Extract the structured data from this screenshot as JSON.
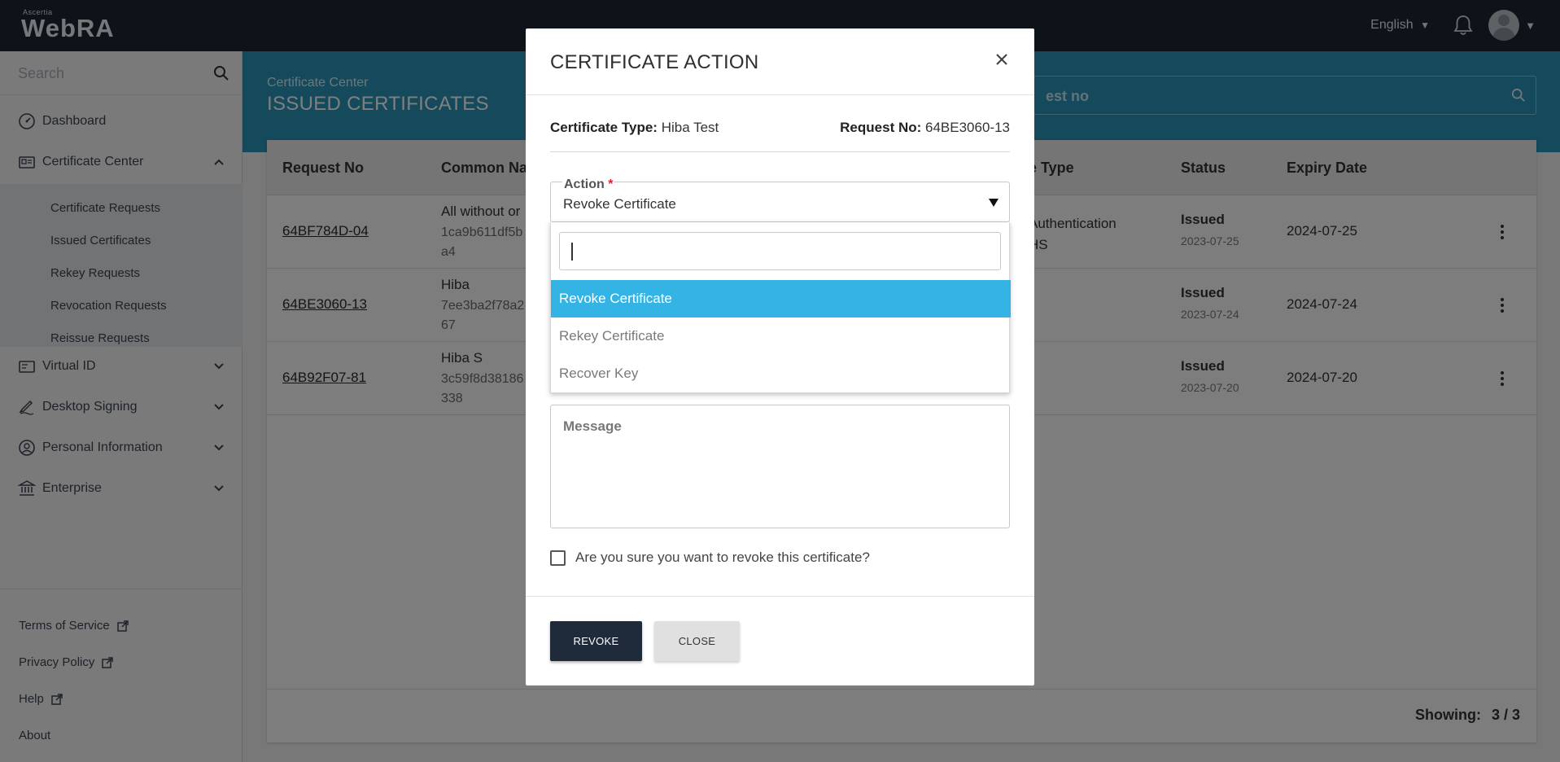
{
  "topbar": {
    "brand_small": "Ascertia",
    "brand": "WebRA",
    "language": "English"
  },
  "sidebar": {
    "search_placeholder": "Search",
    "items": [
      {
        "label": "Dashboard"
      },
      {
        "label": "Certificate Center"
      },
      {
        "label": "Virtual ID"
      },
      {
        "label": "Desktop Signing"
      },
      {
        "label": "Personal Information"
      },
      {
        "label": "Enterprise"
      }
    ],
    "subitems": [
      {
        "label": "Certificate Requests"
      },
      {
        "label": "Issued Certificates"
      },
      {
        "label": "Rekey Requests"
      },
      {
        "label": "Revocation Requests"
      },
      {
        "label": "Reissue Requests"
      }
    ],
    "footer_links": [
      {
        "label": "Terms of Service"
      },
      {
        "label": "Privacy Policy"
      },
      {
        "label": "Help"
      },
      {
        "label": "About"
      }
    ]
  },
  "header": {
    "breadcrumb": "Certificate Center",
    "title": "ISSUED CERTIFICATES",
    "search_placeholder": "est no"
  },
  "table": {
    "columns": [
      "Request No",
      "Common Na",
      "e Type",
      "Status",
      "Expiry Date"
    ],
    "rows": [
      {
        "request_no": "64BF784D-04",
        "cn_name": "All without or",
        "cn_detail": "1ca9b611df5b\na4",
        "type": "Authentication\nHS",
        "status": "Issued",
        "status_date": "2023-07-25",
        "expiry": "2024-07-25"
      },
      {
        "request_no": "64BE3060-13",
        "cn_name": "Hiba",
        "cn_detail": "7ee3ba2f78a2\n67",
        "type": "",
        "status": "Issued",
        "status_date": "2023-07-24",
        "expiry": "2024-07-24"
      },
      {
        "request_no": "64B92F07-81",
        "cn_name": "Hiba S",
        "cn_detail": "3c59f8d38186\n338",
        "type": "",
        "status": "Issued",
        "status_date": "2023-07-20",
        "expiry": "2024-07-20"
      }
    ],
    "showing_label": "Showing:",
    "showing_value": "3 / 3"
  },
  "modal": {
    "title": "CERTIFICATE ACTION",
    "cert_type_label": "Certificate Type:",
    "cert_type_value": "Hiba Test",
    "request_no_label": "Request No:",
    "request_no_value": "64BE3060-13",
    "action_label": "Action",
    "action_required": "*",
    "action_value": "Revoke Certificate",
    "options": [
      "Revoke Certificate",
      "Rekey Certificate",
      "Recover Key"
    ],
    "message_placeholder": "Message",
    "confirm_text": "Are you sure you want to revoke this certificate?",
    "revoke_label": "REVOKE",
    "close_label": "CLOSE"
  },
  "colors": {
    "topbar": "#1d2532",
    "band": "#2a93b9",
    "selected_option": "#34b4e4",
    "primary_button": "#1f2a3a"
  }
}
